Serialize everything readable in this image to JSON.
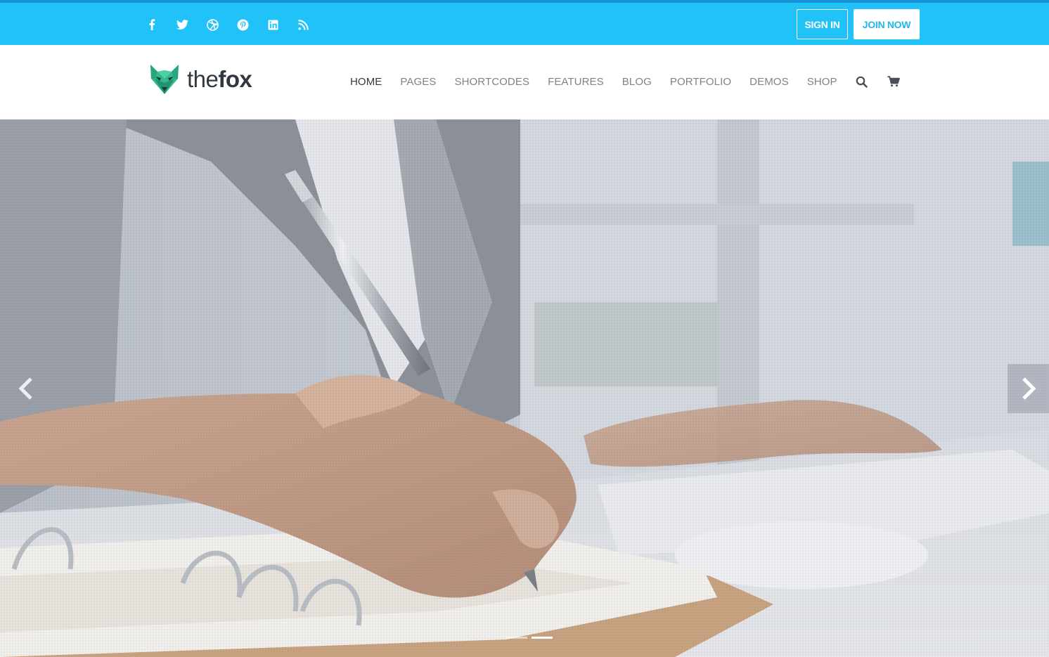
{
  "topbar": {
    "bg_color": "#21c2f8",
    "social_icons": [
      "facebook-icon",
      "twitter-icon",
      "dribbble-icon",
      "pinterest-icon",
      "linkedin-icon",
      "rss-icon"
    ],
    "sign_in_label": "SIGN IN",
    "join_now_label": "JOIN NOW"
  },
  "header": {
    "logo_text_light": "the",
    "logo_text_bold": "fox",
    "logo_color": "#2bb58f",
    "nav": [
      {
        "label": "HOME",
        "active": true
      },
      {
        "label": "PAGES",
        "active": false
      },
      {
        "label": "SHORTCODES",
        "active": false
      },
      {
        "label": "FEATURES",
        "active": false
      },
      {
        "label": "BLOG",
        "active": false
      },
      {
        "label": "PORTFOLIO",
        "active": false
      },
      {
        "label": "DEMOS",
        "active": false
      },
      {
        "label": "SHOP",
        "active": false
      }
    ],
    "nav_icons": [
      "search-icon",
      "cart-icon"
    ]
  },
  "hero": {
    "slides": 2,
    "active_slide": 2,
    "prev_icon": "chevron-left-icon",
    "next_icon": "chevron-right-icon"
  }
}
